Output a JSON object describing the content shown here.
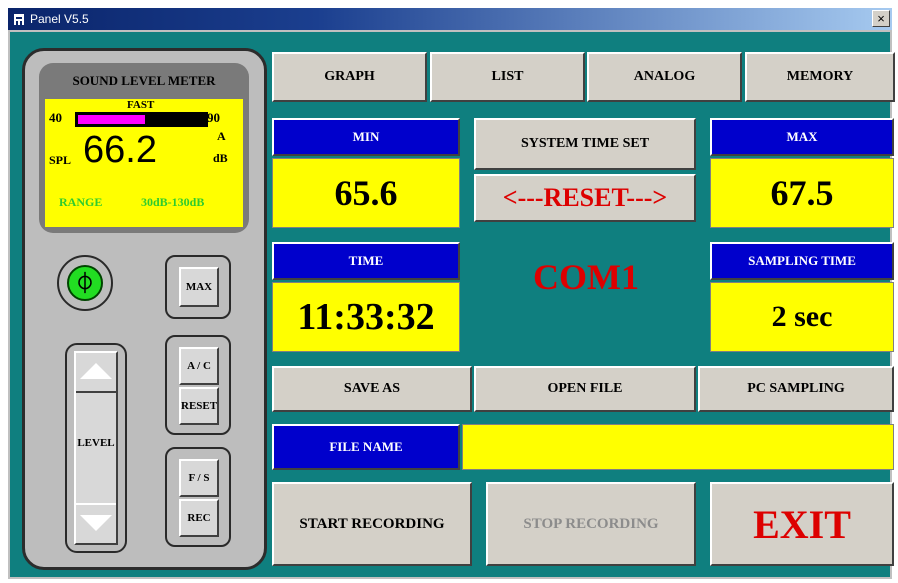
{
  "window": {
    "title": "Panel  V5.5",
    "close_label": "×"
  },
  "meter": {
    "title": "SOUND LEVEL METER",
    "mode": "FAST",
    "bar_min_label": "40",
    "bar_max_label": "90",
    "bar_level_fraction": 0.53,
    "spl_label": "SPL",
    "value": "66.2",
    "unit_weight": "A",
    "unit": "dB",
    "range_label": "RANGE",
    "range_value": "30dB-130dB",
    "buttons": {
      "max": "MAX",
      "ac": "A / C",
      "reset": "RESET",
      "level": "LEVEL",
      "fs": "F / S",
      "rec": "REC"
    },
    "colors": {
      "lcd": "#ffff00",
      "bar": "#ff00ff",
      "range_text": "#2ecc2e",
      "power": "#22dd22"
    }
  },
  "tabs": [
    {
      "label": "GRAPH"
    },
    {
      "label": "LIST"
    },
    {
      "label": "ANALOG"
    },
    {
      "label": "MEMORY"
    }
  ],
  "stats": {
    "min_label": "MIN",
    "min_value": "65.6",
    "max_label": "MAX",
    "max_value": "67.5",
    "time_label": "TIME",
    "time_value": "11:33:32",
    "sampling_label": "SAMPLING TIME",
    "sampling_value": "2 sec"
  },
  "controls": {
    "system_time_set": "SYSTEM TIME SET",
    "reset": "<---RESET--->",
    "port": "COM1",
    "save_as": "SAVE AS",
    "open_file": "OPEN FILE",
    "pc_sampling": "PC SAMPLING",
    "file_name_label": "FILE NAME",
    "file_name_value": "",
    "start_recording": "START RECORDING",
    "stop_recording": "STOP RECORDING",
    "exit": "EXIT"
  },
  "colors": {
    "background": "#0f7f7f",
    "label_blue": "#0000cc",
    "value_yellow": "#ffff00",
    "accent_red": "#dd0000"
  }
}
